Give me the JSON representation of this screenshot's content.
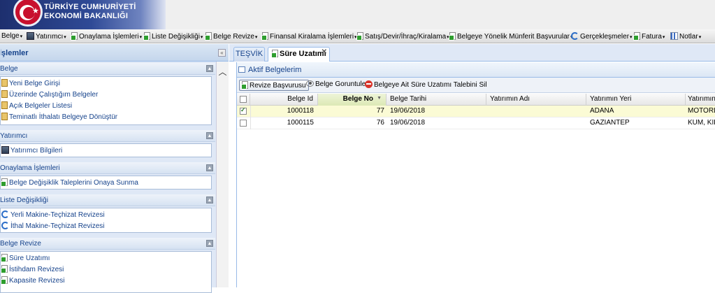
{
  "header": {
    "title_line1": "TÜRKİYE CUMHURİYETİ",
    "title_line2": "EKONOMİ BAKANLIĞI",
    "logo_icon": "turkish-flag-crescent-icon"
  },
  "menu": [
    {
      "label": "Belge",
      "icon": null
    },
    {
      "label": "Yatırımcı",
      "icon": "building-icon"
    },
    {
      "label": "Onaylama İşlemleri",
      "icon": "document-icon"
    },
    {
      "label": "Liste Değişikliği",
      "icon": "document-icon"
    },
    {
      "label": "Belge Revize",
      "icon": "document-icon"
    },
    {
      "label": "Finansal Kiralama İşlemleri",
      "icon": "document-icon"
    },
    {
      "label": "Satış/Devir/İhraç/Kiralama",
      "icon": "document-icon"
    },
    {
      "label": "Belgeye Yönelik Münferit Başvurular",
      "icon": "document-icon"
    },
    {
      "label": "Gerçekleşmeler",
      "icon": "refresh-icon"
    },
    {
      "label": "Fatura",
      "icon": "page-icon"
    },
    {
      "label": "Notlar",
      "icon": "chart-icon"
    }
  ],
  "left_panel": {
    "title": "İşlemler",
    "groups": [
      {
        "title": "Belge",
        "items": [
          "Yeni Belge Girişi",
          "Üzerinde Çalıştığım Belgeler",
          "Açık Belgeler Listesi",
          "Teminatlı İthalatı Belgeye Dönüştür"
        ]
      },
      {
        "title": "Yatırımcı",
        "items": [
          "Yatırımcı Bilgileri"
        ]
      },
      {
        "title": "Onaylama İşlemleri",
        "items": [
          "Belge Değişiklik Taleplerini Onaya Sunma"
        ]
      },
      {
        "title": "Liste Değişikliği",
        "items": [
          "Yerli Makine-Teçhizat Revizesi",
          "İthal Makine-Teçhizat Revizesi"
        ]
      },
      {
        "title": "Belge Revize",
        "items": [
          "Süre Uzatımı",
          "İstihdam Revizesi",
          "Kapasite Revizesi"
        ]
      }
    ]
  },
  "tabs": [
    {
      "label": "TEŞVİK",
      "active": false
    },
    {
      "label": "Süre Uzatımı",
      "active": true,
      "closable": true
    }
  ],
  "panel": {
    "title": "Aktif Belgelerim",
    "toolbar": {
      "revize": "Revize Başvurusu",
      "goruntule": "Belge Goruntule",
      "sil": "Belgeye Ait Süre Uzatımı Talebini Sil"
    }
  },
  "grid": {
    "columns": [
      "Belge Id",
      "Belge No",
      "Belge Tarihi",
      "Yatırımın Adı",
      "Yatırımın Yeri",
      "Yatırımın"
    ],
    "sorted_column": "Belge No",
    "sort_direction": "desc",
    "rows": [
      {
        "selected": true,
        "id": "1000118",
        "no": "77",
        "tarih": "19/06/2018",
        "adi": "",
        "yeri": "ADANA",
        "extra": "MOTORLU"
      },
      {
        "selected": false,
        "id": "1000115",
        "no": "76",
        "tarih": "19/06/2018",
        "adi": "",
        "yeri": "GAZİANTEP",
        "extra": "KUM, KİL"
      }
    ]
  },
  "colors": {
    "banner": "#2f4a96",
    "panel_bg": "#dfe8f6",
    "link": "#15428b",
    "selected_row": "#fbfbd5"
  }
}
